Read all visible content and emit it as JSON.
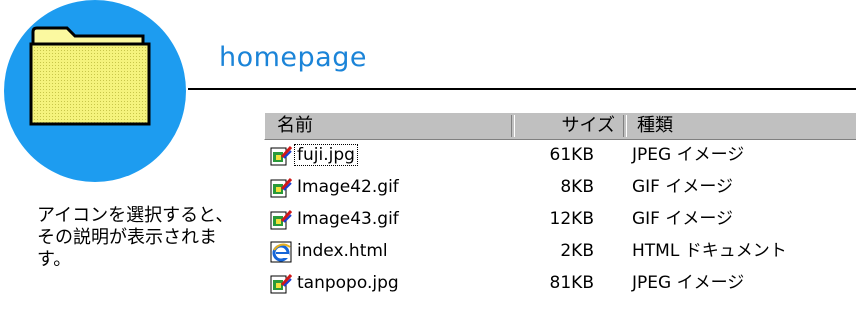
{
  "folder": {
    "icon": "folder-icon",
    "title": "homepage"
  },
  "description": "アイコンを選択すると、その説明が表示されます。",
  "columns": {
    "name": "名前",
    "size": "サイズ",
    "type": "種類"
  },
  "files": [
    {
      "name": "fuji.jpg",
      "size": "61KB",
      "type": "JPEG イメージ",
      "icon": "image-file-icon",
      "selected": true
    },
    {
      "name": "Image42.gif",
      "size": "8KB",
      "type": "GIF イメージ",
      "icon": "image-file-icon",
      "selected": false
    },
    {
      "name": "Image43.gif",
      "size": "12KB",
      "type": "GIF イメージ",
      "icon": "image-file-icon",
      "selected": false
    },
    {
      "name": "index.html",
      "size": "2KB",
      "type": "HTML ドキュメント",
      "icon": "ie-document-icon",
      "selected": false
    },
    {
      "name": "tanpopo.jpg",
      "size": "81KB",
      "type": "JPEG イメージ",
      "icon": "image-file-icon",
      "selected": false
    }
  ],
  "colors": {
    "badge": "#1d9cf0",
    "title": "#1b84d8",
    "folder": "#f2f07a"
  }
}
